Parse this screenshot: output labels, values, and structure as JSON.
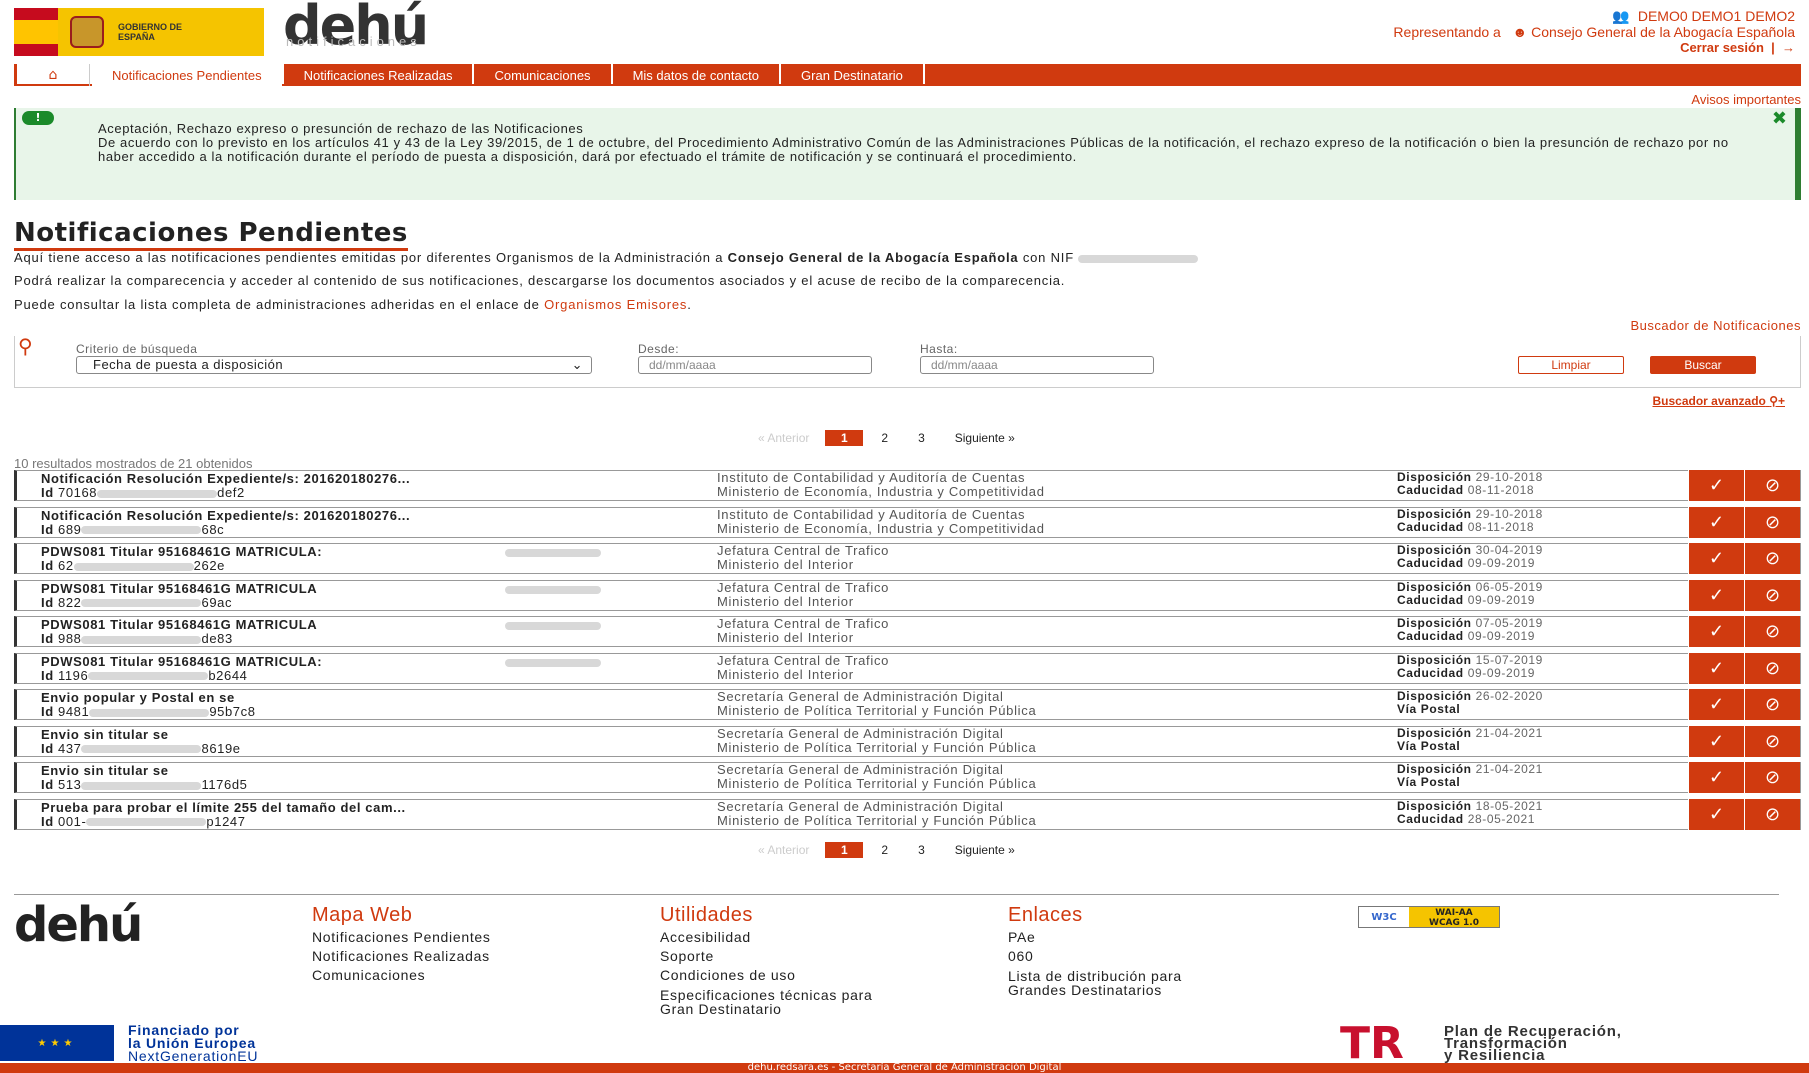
{
  "header": {
    "gov_label": "GOBIERNO DE ESPAÑA",
    "logo": "dehú",
    "logo_sub": "notificaciones",
    "user_name": "DEMO0 DEMO1 DEMO2",
    "representando_label": "Representando a",
    "representado": "Consejo General de la Abogacía Española",
    "logout": "Cerrar sesión"
  },
  "nav": {
    "home_icon": "home-icon",
    "tabs": [
      "Notificaciones Pendientes",
      "Notificaciones Realizadas",
      "Comunicaciones",
      "Mis datos de contacto",
      "Gran Destinatario"
    ],
    "active_index": 0
  },
  "avisos": "Avisos importantes",
  "alert": {
    "title": "Aceptación, Rechazo expreso o presunción de rechazo de las Notificaciones",
    "body": "De acuerdo con lo previsto en los artículos 41 y 43 de la Ley 39/2015, de 1 de octubre, del Procedimiento Administrativo Común de las Administraciones Públicas de la notificación, el rechazo expreso de la notificación o bien la presunción de rechazo por no haber accedido a la notificación durante el período de puesta a disposición, dará por efectuado el trámite de notificación y se continuará el procedimiento."
  },
  "page": {
    "title": "Notificaciones Pendientes",
    "intro1_a": "Aquí tiene acceso a las notificaciones pendientes emitidas por diferentes Organismos de la Administración a ",
    "intro1_b": "Consejo General de la Abogacía Española",
    "intro1_c": " con NIF ",
    "intro2": "Podrá realizar la comparecencia y acceder al contenido de sus notificaciones, descargarse los documentos asociados y el acuse de recibo de la comparecencia.",
    "intro3_a": "Puede consultar la lista completa de administraciones adheridas en el enlace de ",
    "intro3_link": "Organismos Emisores",
    "intro3_end": "."
  },
  "search": {
    "title": "Buscador de Notificaciones",
    "criterio_label": "Criterio de búsqueda",
    "criterio_value": "Fecha de puesta a disposición",
    "desde_label": "Desde:",
    "hasta_label": "Hasta:",
    "date_placeholder": "dd/mm/aaaa",
    "limpiar": "Limpiar",
    "buscar": "Buscar",
    "avanzado": "Buscador avanzado"
  },
  "pagination": {
    "prev": "«  Anterior",
    "current": "1",
    "pages": [
      "2",
      "3"
    ],
    "next": "Siguiente  »"
  },
  "results_summary": "10 resultados mostrados de 21 obtenidos",
  "rows": [
    {
      "title": "Notificación Resolución Expediente/s: 201620180276...",
      "id_a": "70168",
      "id_b": "def2",
      "org1": "Instituto de Contabilidad y Auditoría de Cuentas",
      "org2": "Ministerio de Economía, Industria y Competitividad",
      "d1l": "Disposición",
      "d1v": "29-10-2018",
      "d2l": "Caducidad",
      "d2v": "08-11-2018"
    },
    {
      "title": "Notificación Resolución Expediente/s: 201620180276...",
      "id_a": "689",
      "id_b": "68c",
      "org1": "Instituto de Contabilidad y Auditoría de Cuentas",
      "org2": "Ministerio de Economía, Industria y Competitividad",
      "d1l": "Disposición",
      "d1v": "29-10-2018",
      "d2l": "Caducidad",
      "d2v": "08-11-2018"
    },
    {
      "title": "PDWS081 Titular 95168461G MATRICULA:",
      "id_a": "62",
      "id_b": "262e",
      "org1": "Jefatura Central de Trafico",
      "org2": "Ministerio del Interior",
      "d1l": "Disposición",
      "d1v": "30-04-2019",
      "d2l": "Caducidad",
      "d2v": "09-09-2019"
    },
    {
      "title": "PDWS081 Titular 95168461G MATRICULA",
      "id_a": "822",
      "id_b": "69ac",
      "org1": "Jefatura Central de Trafico",
      "org2": "Ministerio del Interior",
      "d1l": "Disposición",
      "d1v": "06-05-2019",
      "d2l": "Caducidad",
      "d2v": "09-09-2019"
    },
    {
      "title": "PDWS081 Titular 95168461G MATRICULA",
      "id_a": "988",
      "id_b": "de83",
      "org1": "Jefatura Central de Trafico",
      "org2": "Ministerio del Interior",
      "d1l": "Disposición",
      "d1v": "07-05-2019",
      "d2l": "Caducidad",
      "d2v": "09-09-2019"
    },
    {
      "title": "PDWS081 Titular 95168461G MATRICULA:",
      "id_a": "1196",
      "id_b": "b2644",
      "org1": "Jefatura Central de Trafico",
      "org2": "Ministerio del Interior",
      "d1l": "Disposición",
      "d1v": "15-07-2019",
      "d2l": "Caducidad",
      "d2v": "09-09-2019"
    },
    {
      "title": "Envio popular y Postal en se",
      "id_a": "9481",
      "id_b": "95b7c8",
      "org1": "Secretaría General de Administración Digital",
      "org2": "Ministerio de Política Territorial y Función Pública",
      "d1l": "Disposición",
      "d1v": "26-02-2020",
      "d2l": "Vía Postal",
      "d2v": ""
    },
    {
      "title": "Envio sin titular se",
      "id_a": "437",
      "id_b": "8619e",
      "org1": "Secretaría General de Administración Digital",
      "org2": "Ministerio de Política Territorial y Función Pública",
      "d1l": "Disposición",
      "d1v": "21-04-2021",
      "d2l": "Vía Postal",
      "d2v": ""
    },
    {
      "title": "Envio sin titular se",
      "id_a": "513",
      "id_b": "1176d5",
      "org1": "Secretaría General de Administración Digital",
      "org2": "Ministerio de Política Territorial y Función Pública",
      "d1l": "Disposición",
      "d1v": "21-04-2021",
      "d2l": "Vía Postal",
      "d2v": ""
    },
    {
      "title": "Prueba para probar el límite 255 del tamaño del cam...",
      "id_a": "001-",
      "id_b": "p1247",
      "org1": "Secretaría General de Administración Digital",
      "org2": "Ministerio de Política Territorial y Función Pública",
      "d1l": "Disposición",
      "d1v": "18-05-2021",
      "d2l": "Caducidad",
      "d2v": "28-05-2021"
    }
  ],
  "id_label": "Id",
  "footer": {
    "logo": "dehú",
    "mapa": {
      "title": "Mapa Web",
      "items": [
        "Notificaciones Pendientes",
        "Notificaciones Realizadas",
        "Comunicaciones"
      ]
    },
    "util": {
      "title": "Utilidades",
      "items": [
        "Accesibilidad",
        "Soporte",
        "Condiciones de uso",
        "Especificaciones técnicas para",
        "Gran Destinatario"
      ]
    },
    "enlaces": {
      "title": "Enlaces",
      "items": [
        "PAe",
        "060",
        "Lista de distribución para",
        "Grandes Destinatarios"
      ]
    },
    "w3c_a": "W3C",
    "w3c_b1": "WAI-AA",
    "w3c_b2": "WCAG 1.0",
    "eu_1": "Financiado por",
    "eu_2": "la Unión Europea",
    "eu_3": "NextGenerationEU",
    "tr_logo": "TR",
    "tr_1": "Plan de Recuperación,",
    "tr_2": "Transformación",
    "tr_3": "y Resiliencia",
    "bottom": "dehu.redsara.es - Secretaría General de Administración Digital"
  },
  "colors": {
    "accent": "#d03a0f",
    "alert_bg": "#e8f5e9",
    "alert_border": "#2e7d32"
  }
}
